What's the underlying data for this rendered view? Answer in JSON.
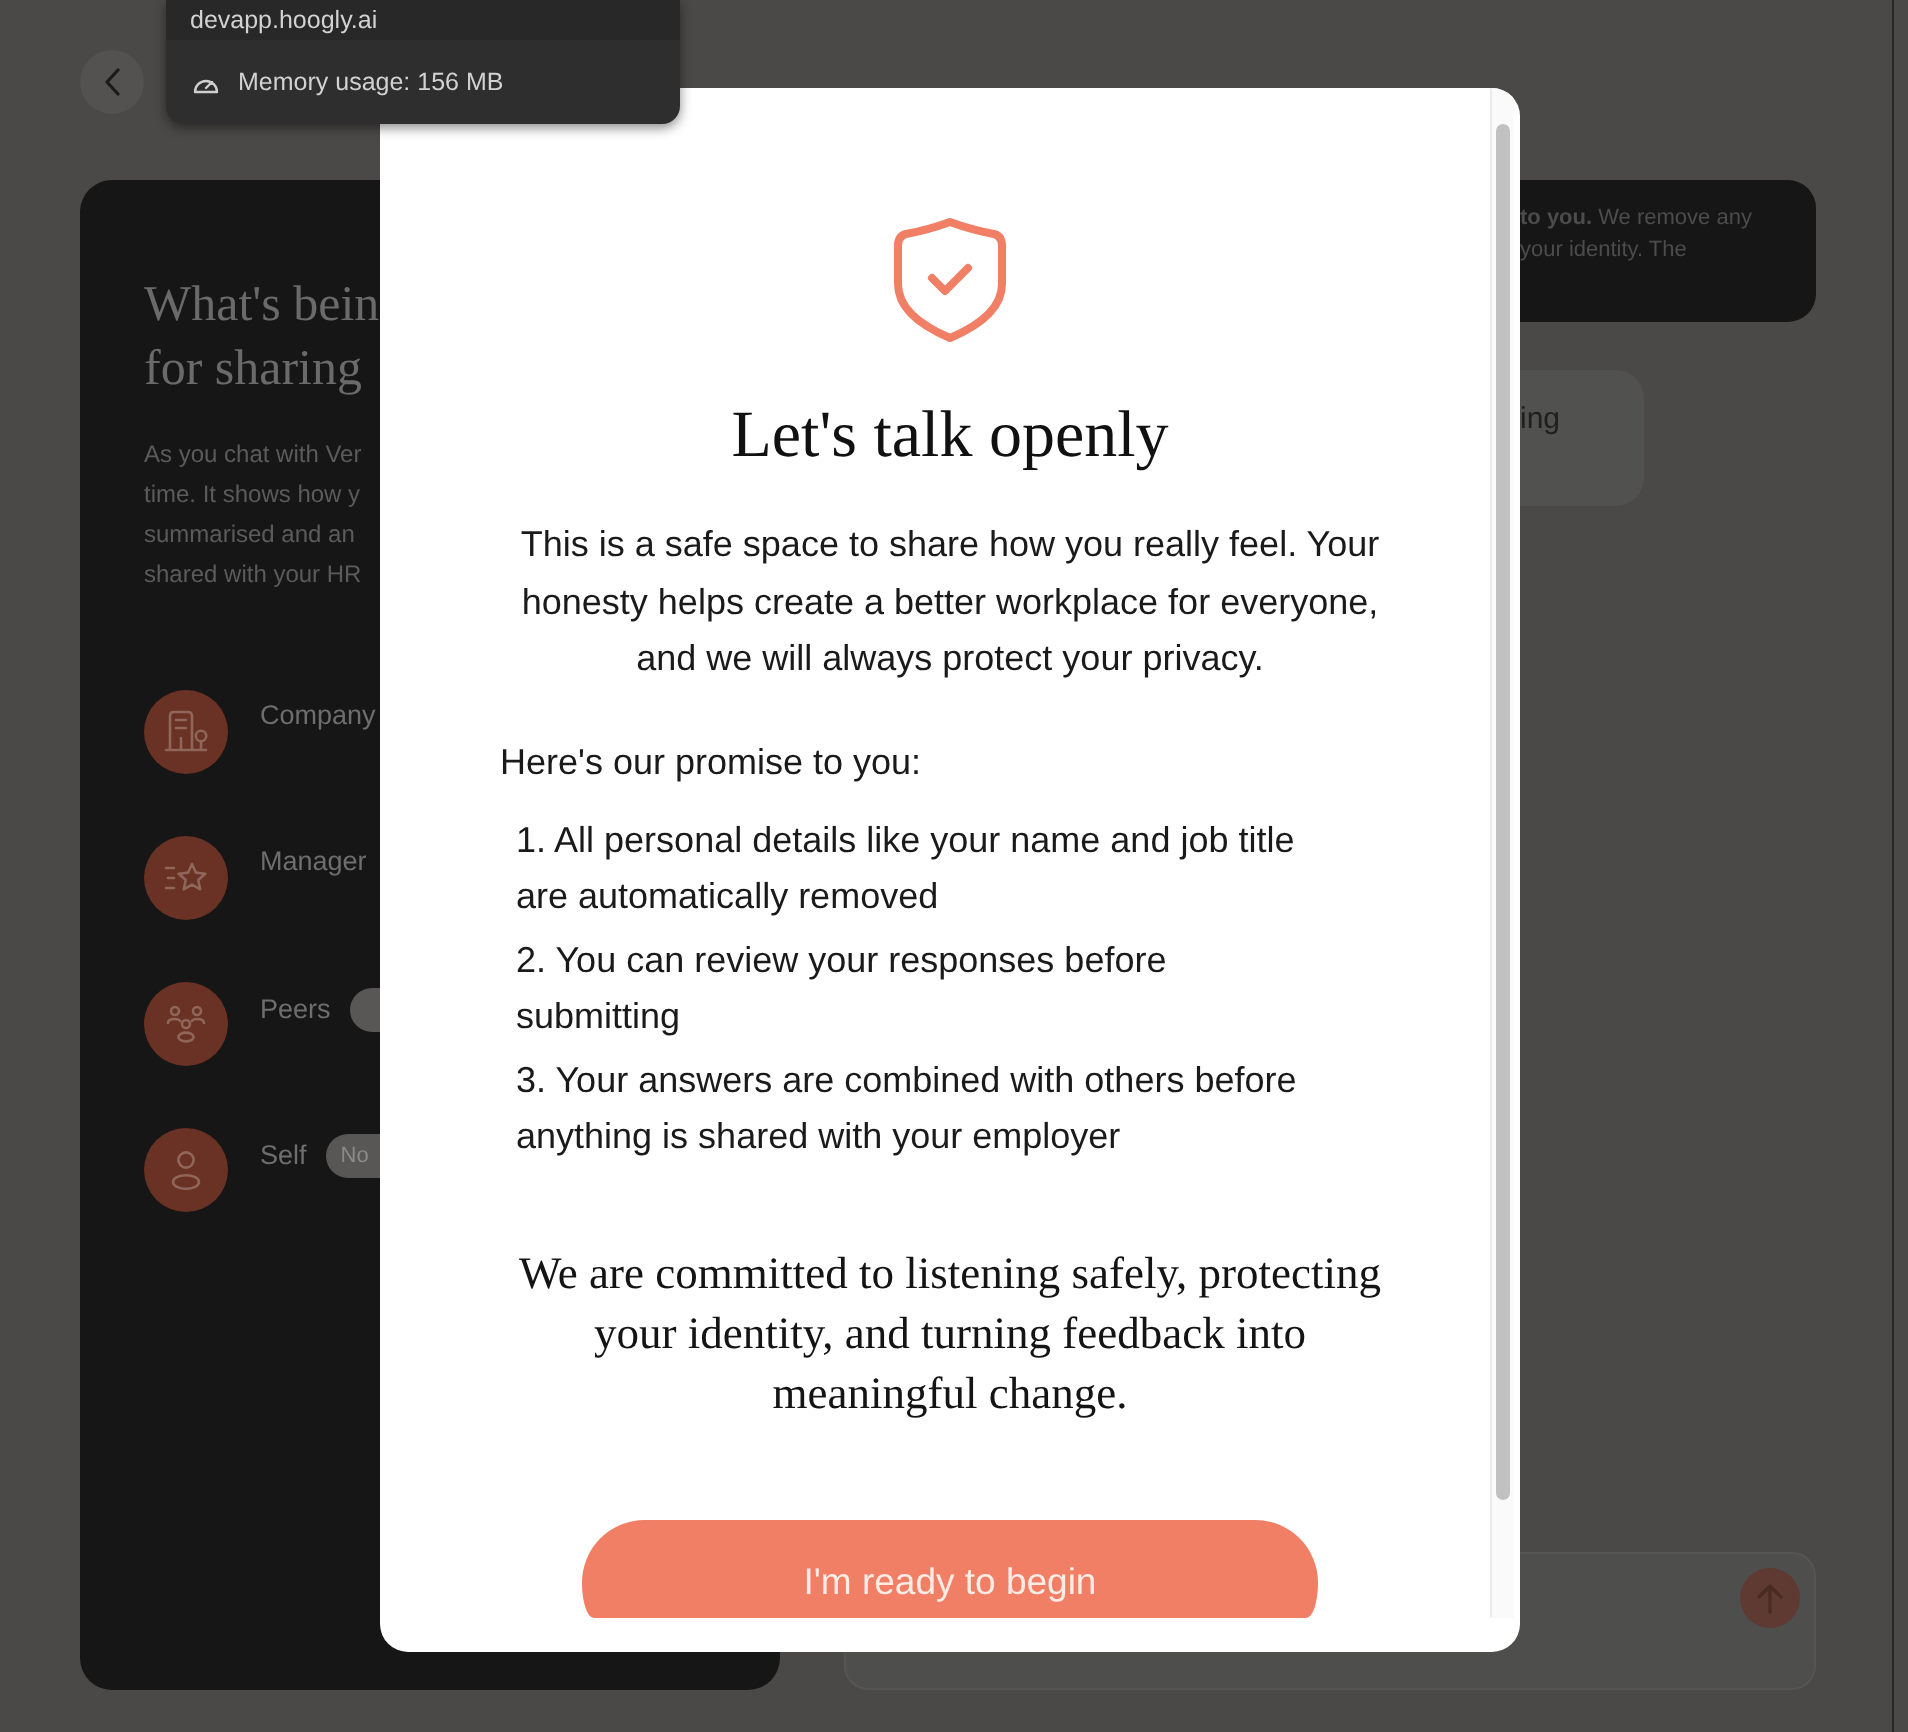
{
  "tooltip": {
    "url": "devapp.hoogly.ai",
    "memory": "Memory usage: 156 MB"
  },
  "side_panel": {
    "title_lines": [
      "What's bein",
      "for sharing"
    ],
    "description_lines": [
      "As you chat with Ver",
      "time. It shows how y",
      "summarised and an",
      "shared with your HR"
    ],
    "items": [
      {
        "kind": "company",
        "label": "Company",
        "has_badge": false
      },
      {
        "kind": "manager",
        "label": "Manager",
        "has_badge": false
      },
      {
        "kind": "peers",
        "label": "Peers",
        "has_badge": true
      },
      {
        "kind": "self",
        "label": "Self",
        "has_badge": true,
        "badge": "No"
      }
    ]
  },
  "chat": {
    "messages": [
      {
        "kind": "notice",
        "lines": [
          "**to you.** We remove any",
          "your identity. The"
        ]
      },
      {
        "kind": "reply",
        "lines": [
          "ing"
        ]
      }
    ]
  },
  "dialog": {
    "title": "Let's talk openly",
    "intro": "This is a safe space to share how you really feel. Your honesty helps create a better workplace for everyone, and we will always protect your privacy.",
    "promise_heading": "Here's our promise to you:",
    "promises": [
      {
        "number": "1.",
        "text": "All personal details like your name and job title are automatically removed"
      },
      {
        "number": "2.",
        "text": "You can review your responses before submitting"
      },
      {
        "number": "3.",
        "text": "Your answers are combined with others before anything is shared with your employer"
      }
    ],
    "closing": "We are committed to listening safely, protecting your identity, and turning feedback into meaningful change.",
    "button": "I'm ready to begin"
  }
}
